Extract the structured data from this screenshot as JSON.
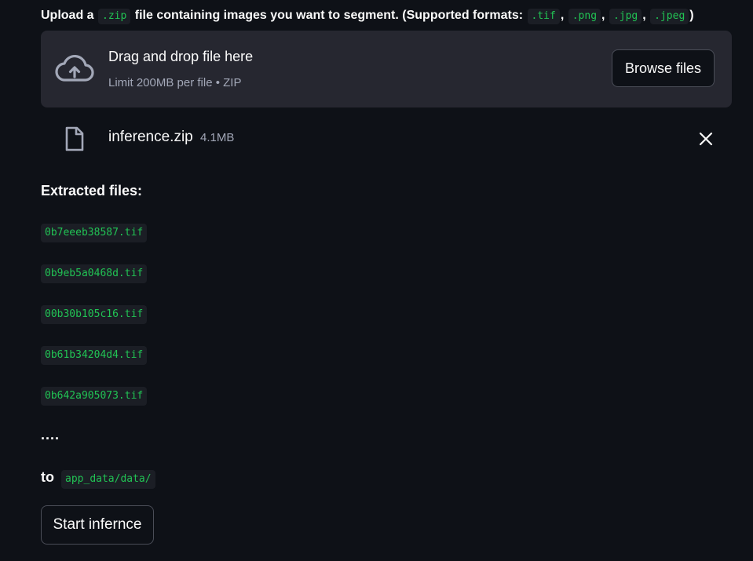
{
  "uploader": {
    "label_prefix": "Upload a",
    "zip_ext": ".zip",
    "label_middle": "file containing images you want to segment. (Supported formats:",
    "formats": [
      ".tif",
      ".png",
      ".jpg",
      ".jpeg"
    ],
    "separator": ",",
    "label_suffix": ")",
    "dropzone_title": "Drag and drop file here",
    "dropzone_subtitle": "Limit 200MB per file • ZIP",
    "browse_label": "Browse files",
    "icon": "cloud-upload-icon"
  },
  "uploaded_file": {
    "name": "inference.zip",
    "size": "4.1MB",
    "icon": "file-icon",
    "remove_icon": "close-icon"
  },
  "extracted": {
    "title": "Extracted files:",
    "files": [
      "0b7eeeb38587.tif",
      "0b9eb5a0468d.tif",
      "00b30b105c16.tif",
      "0b61b34204d4.tif",
      "0b642a905073.tif"
    ],
    "ellipsis": "....",
    "dest_prefix": "to",
    "dest_path": "app_data/data/"
  },
  "actions": {
    "start_label": "Start infernce"
  },
  "colors": {
    "background": "#0e1117",
    "panel": "#262730",
    "code_text": "#21c354",
    "code_bg": "#1b1e25"
  }
}
